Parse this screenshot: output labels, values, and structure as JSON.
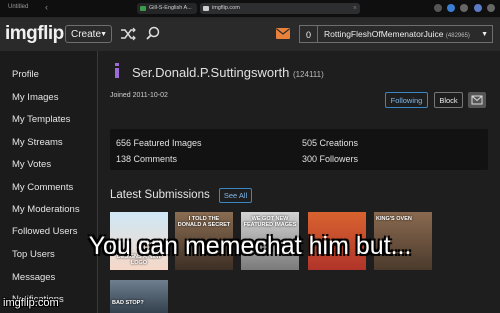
{
  "browser": {
    "tab_title_left": "Untitled",
    "tab1_title": "Gill-S-English A...",
    "tab2_title": "imgflip.com"
  },
  "header": {
    "logo": "imgflip",
    "create_label": "Create",
    "notification_count": "0",
    "username": "RottingFleshOfMemenatorJuice",
    "user_points": "(482965)"
  },
  "sidebar": {
    "items": [
      {
        "label": "Profile"
      },
      {
        "label": "My Images"
      },
      {
        "label": "My Templates"
      },
      {
        "label": "My Streams"
      },
      {
        "label": "My Votes"
      },
      {
        "label": "My Comments"
      },
      {
        "label": "My Moderations"
      },
      {
        "label": "Followed Users"
      },
      {
        "label": "Top Users"
      },
      {
        "label": "Messages"
      },
      {
        "label": "Notifications"
      }
    ]
  },
  "profile": {
    "username": "Ser.Donald.P.Suttingsworth",
    "points": "(124111)",
    "joined": "Joined 2011-10-02",
    "following_label": "Following",
    "block_label": "Block",
    "stats": {
      "featured_images": "656 Featured Images",
      "creations": "505 Creations",
      "comments": "138 Comments",
      "followers": "300 Followers"
    },
    "latest_title": "Latest Submissions",
    "see_all_label": "See All",
    "thumbnails": [
      {
        "caption": "DESIGNS A NEW LOGO"
      },
      {
        "caption": "I TOLD THE DONALD A SECRET"
      },
      {
        "caption": "WE GOT NEW FEATURED IMAGES"
      },
      {
        "caption": ""
      },
      {
        "caption": "KING'S OVEN"
      },
      {
        "caption": "BAD STOP?"
      }
    ]
  },
  "meme": {
    "caption": "You can memechat him but...",
    "watermark": "imgflip.com"
  },
  "colors": {
    "accent_blue": "#3a86c4",
    "mail_orange": "#e9813a",
    "user_purple": "#9b6bd6"
  }
}
